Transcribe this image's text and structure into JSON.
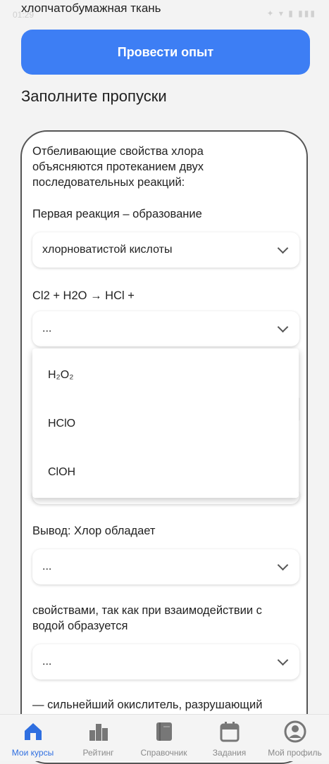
{
  "status": {
    "time": "01:29",
    "icons": "✦ ▾ ▮ ▮▮▮"
  },
  "top_text": "хлопчатобумажная ткань",
  "primary_button": "Провести опыт",
  "section_title": "Заполните пропуски",
  "card": {
    "intro": "Отбеливающие свойства хлора объясняются протеканием двух последовательных реакций:",
    "first_reaction": "Первая реакция – образование",
    "select1_value": "хлорноватистой кислоты",
    "equation": "Cl2 + H2O → HCl +",
    "select2_value": "...",
    "dropdown_options": [
      "H₂O₂",
      "HClO",
      "ClOH"
    ],
    "conclusion": "Вывод: Хлор обладает",
    "select3_value": "...",
    "properties_text": "свойствами, так как при взаимодействии с водой образуется",
    "select4_value": "...",
    "tail_text": "— сильнейший окислитель, разрушающий"
  },
  "nav": {
    "items": [
      {
        "label": "Мои курсы",
        "icon": "home-icon",
        "active": true
      },
      {
        "label": "Рейтинг",
        "icon": "rating-icon",
        "active": false
      },
      {
        "label": "Справочник",
        "icon": "book-icon",
        "active": false
      },
      {
        "label": "Задания",
        "icon": "calendar-icon",
        "active": false
      },
      {
        "label": "Мой профиль",
        "icon": "profile-icon",
        "active": false
      }
    ]
  },
  "colors": {
    "accent": "#3d7ef4",
    "nav_active": "#2f6fe0",
    "nav_inactive": "#8a8a8a"
  }
}
